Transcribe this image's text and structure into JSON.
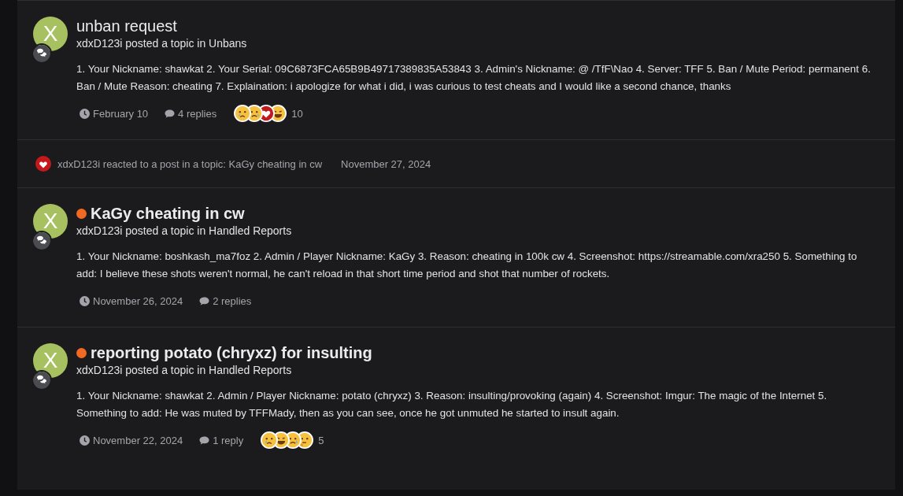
{
  "items": [
    {
      "kind": "topic",
      "avatar": "X",
      "unread": false,
      "title": "unban request",
      "subtitle": "xdxD123i posted a topic in Unbans",
      "body": "1. Your Nickname: shawkat 2. Your Serial: 09C6873FCA65B9B49717389835A53843 3. Admin's Nickname: @ /TfF\\Nao 4. Server: TFF 5. Ban / Mute Period: permanent 6. Ban / Mute Reason: cheating 7. Explaination: i apologize for what i did, i was curious to test cheats and I would like a second chance, thanks",
      "date": "February 10",
      "replies": "4 replies",
      "reactions": [
        {
          "kind": "cry"
        },
        {
          "kind": "sad"
        },
        {
          "kind": "heart"
        },
        {
          "kind": "laugh"
        }
      ],
      "reaction_count": "10"
    },
    {
      "kind": "activity",
      "text": "xdxD123i reacted to a post in a topic: KaGy cheating in cw",
      "date": "November 27, 2024"
    },
    {
      "kind": "topic",
      "avatar": "X",
      "unread": true,
      "title": "KaGy cheating in cw",
      "subtitle": "xdxD123i posted a topic in Handled Reports",
      "body": "1. Your Nickname: boshkash_ma7foz 2. Admin / Player Nickname: KaGy 3. Reason: cheating in 100k cw 4. Screenshot: https://streamable.com/xra250 5. Something to add: I believe these shots weren't normal, he can't reload in that short time period and shot that number of rockets.",
      "date": "November 26, 2024",
      "replies": "2 replies"
    },
    {
      "kind": "topic",
      "avatar": "X",
      "unread": true,
      "title": "reporting potato (chryxz) for insulting",
      "subtitle": "xdxD123i posted a topic in Handled Reports",
      "body": "1. Your Nickname: shawkat 2. Admin / Player Nickname: potato (chryxz) 3. Reason: insulting/provoking (again) 4. Screenshot: Imgur: The magic of the Internet 5. Something to add: He was muted by TFFMady, then as you can see, once he got unmuted he started to insult again.",
      "date": "November 22, 2024",
      "replies": "1 reply",
      "reactions": [
        {
          "kind": "cry"
        },
        {
          "kind": "laugh"
        },
        {
          "kind": "sad"
        },
        {
          "kind": "think"
        }
      ],
      "reaction_count": "5"
    }
  ]
}
